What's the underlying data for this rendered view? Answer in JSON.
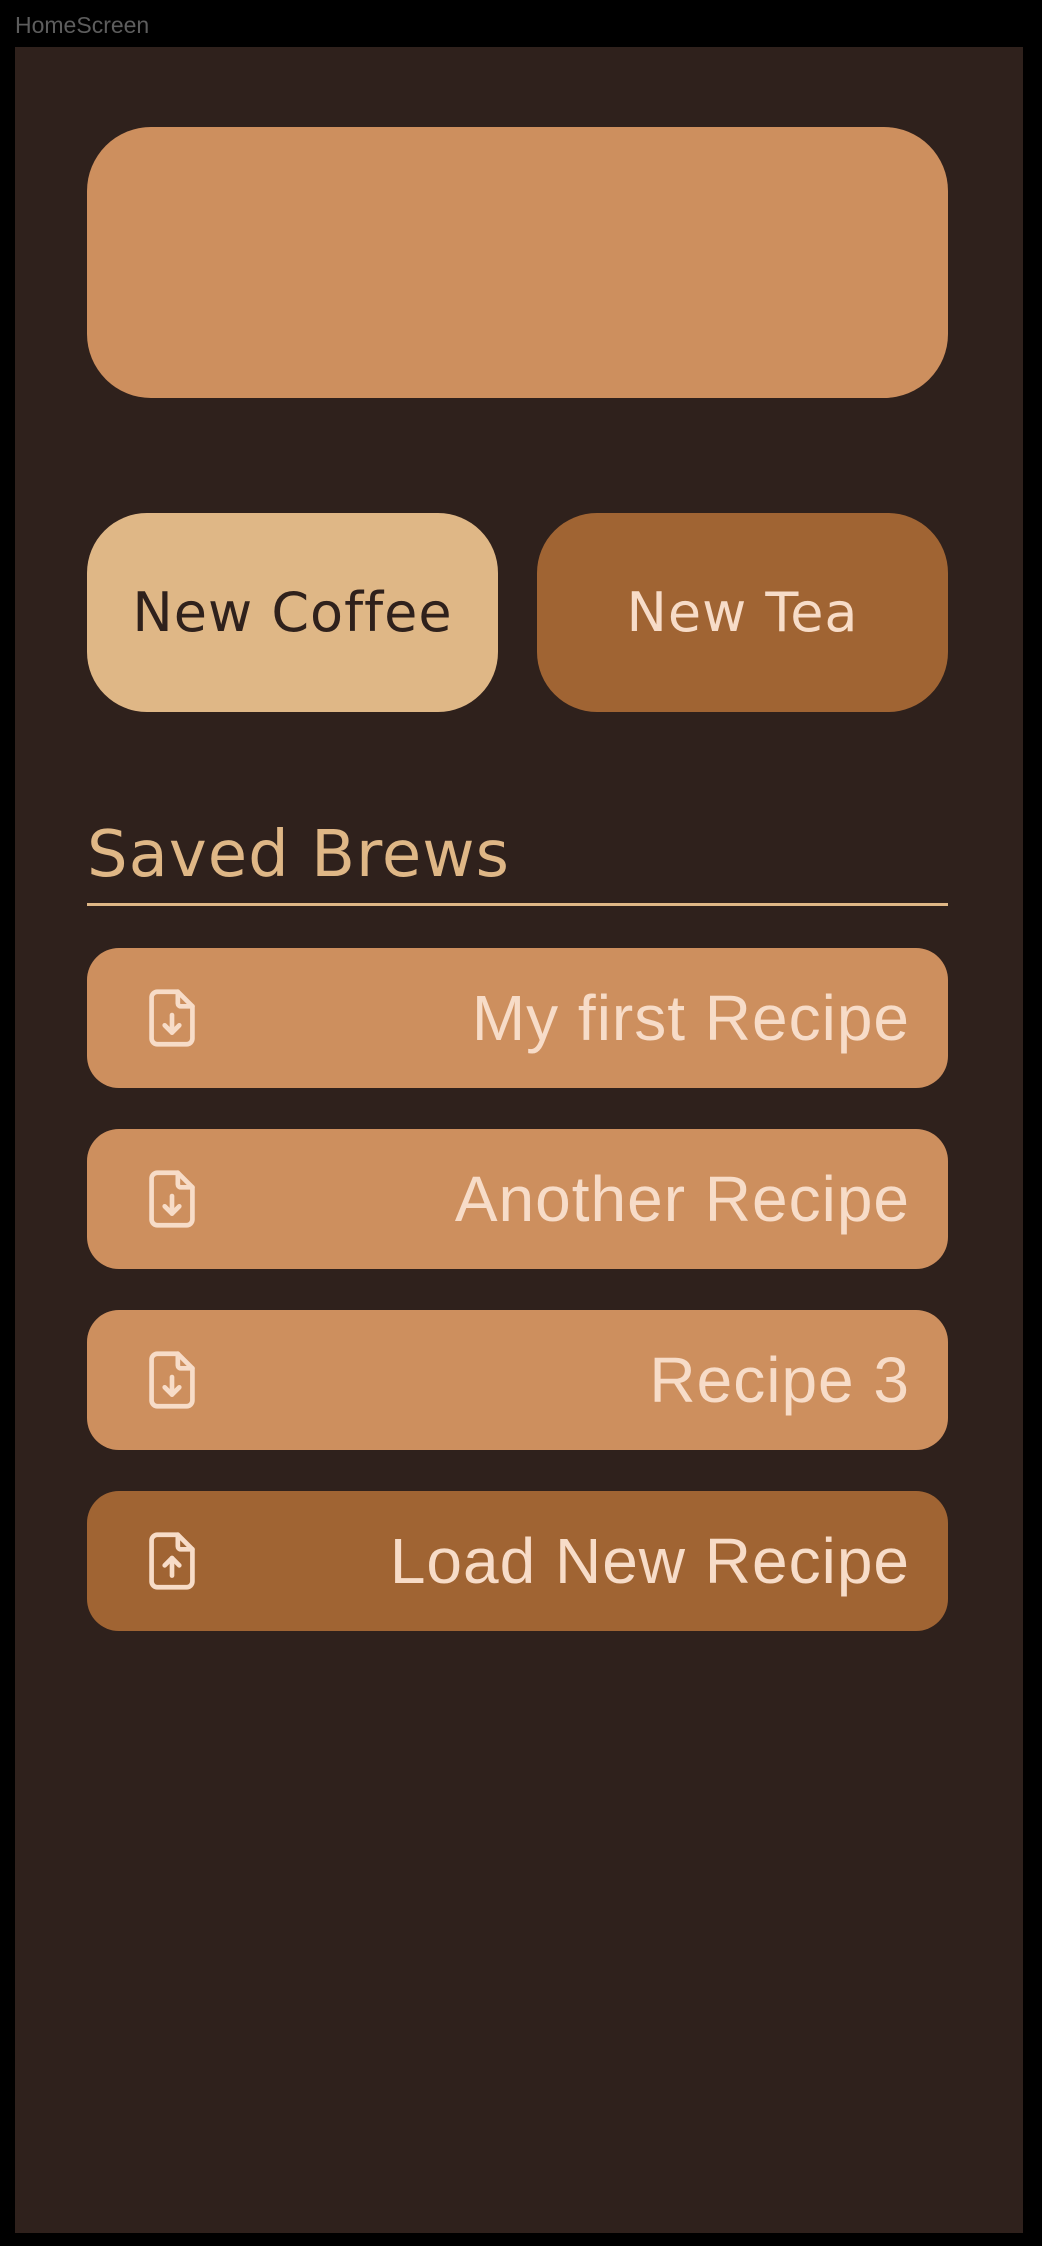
{
  "frame": {
    "label": "HomeScreen"
  },
  "actions": {
    "new_coffee_label": "New Coffee",
    "new_tea_label": "New Tea"
  },
  "saved_brews": {
    "title": "Saved Brews",
    "items": [
      {
        "label": "My first Recipe",
        "icon": "file-download-icon"
      },
      {
        "label": "Another Recipe",
        "icon": "file-download-icon"
      },
      {
        "label": "Recipe 3",
        "icon": "file-download-icon"
      }
    ],
    "load_new": {
      "label": "Load New Recipe",
      "icon": "file-upload-icon"
    }
  },
  "colors": {
    "background": "#2f211c",
    "banner": "#cd8f5e",
    "coffee_button": "#dfb786",
    "tea_button": "#a06433",
    "text_light": "#f7dcc8",
    "accent": "#dfb786"
  }
}
